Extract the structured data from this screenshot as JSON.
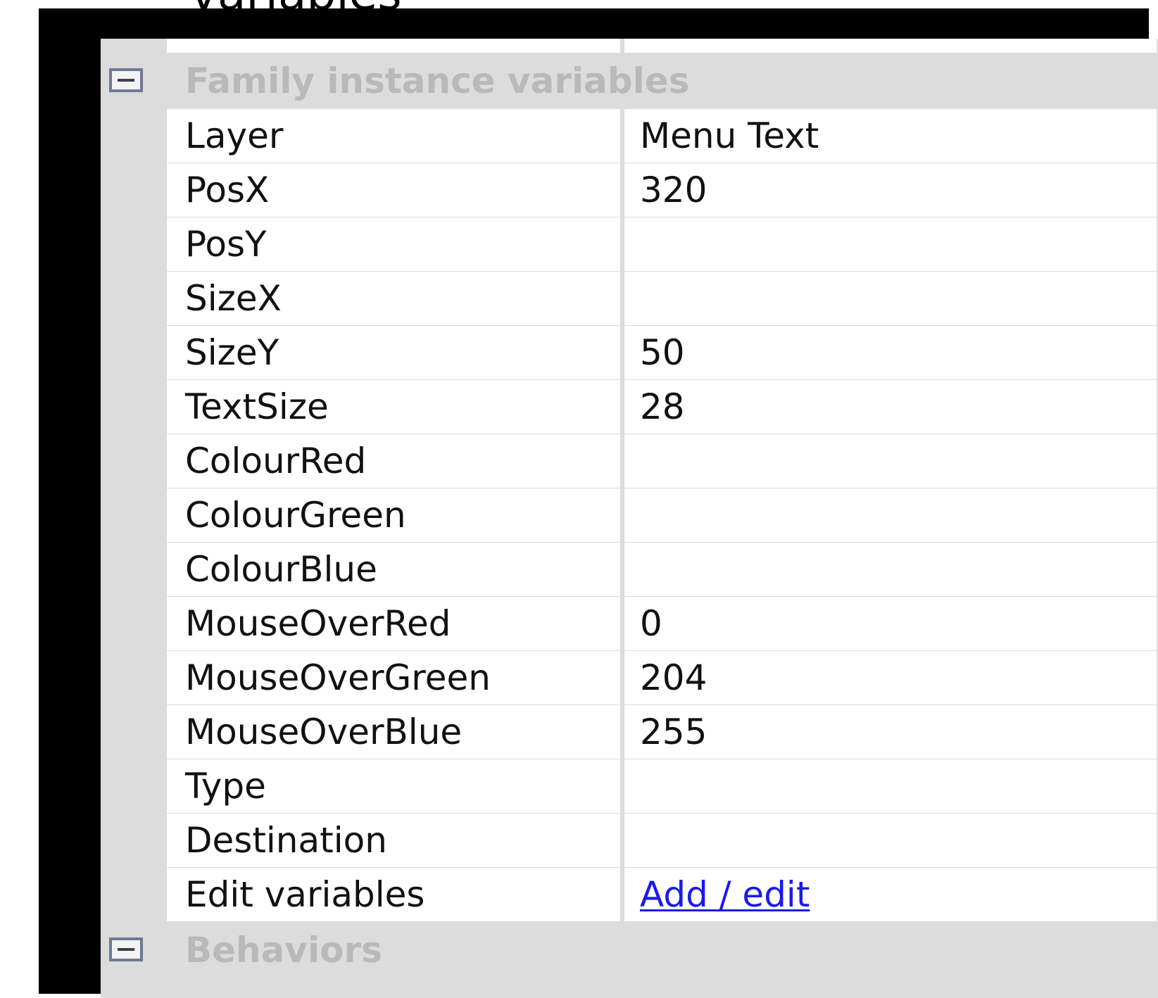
{
  "caption_fragment": "variables",
  "family_instance_section": {
    "title": "Family instance variables",
    "toggle_icon": "minus-collapse-icon",
    "rows": [
      {
        "name": "Layer",
        "value": "Menu Text"
      },
      {
        "name": "PosX",
        "value": "320"
      },
      {
        "name": "PosY",
        "value": ""
      },
      {
        "name": "SizeX",
        "value": ""
      },
      {
        "name": "SizeY",
        "value": "50"
      },
      {
        "name": "TextSize",
        "value": "28"
      },
      {
        "name": "ColourRed",
        "value": ""
      },
      {
        "name": "ColourGreen",
        "value": ""
      },
      {
        "name": "ColourBlue",
        "value": ""
      },
      {
        "name": "MouseOverRed",
        "value": "0"
      },
      {
        "name": "MouseOverGreen",
        "value": "204"
      },
      {
        "name": "MouseOverBlue",
        "value": "255"
      },
      {
        "name": "Type",
        "value": ""
      },
      {
        "name": "Destination",
        "value": ""
      }
    ],
    "edit_row": {
      "name": "Edit variables",
      "link_label": "Add / edit"
    }
  },
  "behaviors_section": {
    "title": "Behaviors",
    "toggle_icon": "minus-collapse-icon"
  },
  "colors": {
    "frame": "#000000",
    "panel_background": "#dcdcdc",
    "cell_background": "#ffffff",
    "category_text": "#b9b9b9",
    "property_text": "#111111",
    "link": "#1a1aee"
  }
}
